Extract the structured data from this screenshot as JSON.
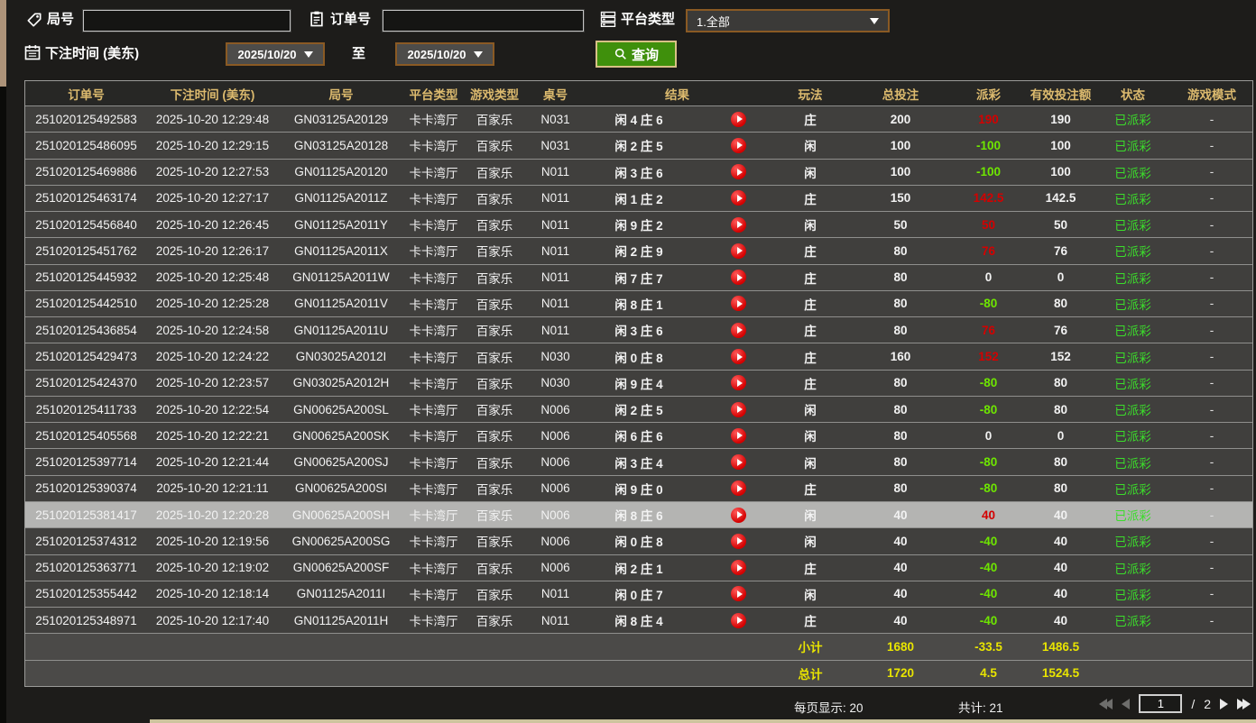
{
  "filters": {
    "round_no_label": "局号",
    "round_no_value": "",
    "order_no_label": "订单号",
    "order_no_value": "",
    "platform_label": "平台类型",
    "platform_value": "1.全部",
    "bet_time_label": "下注时间 (美东)",
    "date_from": "2025/10/20",
    "to_label": "至",
    "date_to": "2025/10/20",
    "query_label": "查询"
  },
  "colors": {
    "header_gold": "#dcba6e",
    "win_red": "#d40000",
    "loss_green": "#6ee600",
    "status_green": "#3bdd2b",
    "summary_yellow": "#e9e500",
    "query_button_green": "#3f900c"
  },
  "table": {
    "columns": [
      "订单号",
      "下注时间 (美东)",
      "局号",
      "平台类型",
      "游戏类型",
      "桌号",
      "结果",
      "玩法",
      "总投注",
      "派彩",
      "有效投注额",
      "状态",
      "游戏模式"
    ],
    "rows": [
      {
        "order": "251020125492583",
        "time": "2025-10-20 12:29:48",
        "round": "GN03125A20129",
        "platform": "卡卡湾厅",
        "game": "百家乐",
        "table_no": "N031",
        "result": "闲 4 庄 6",
        "play": "庄",
        "total_bet": "200",
        "payout": "190",
        "payout_class": "pos",
        "valid_bet": "190",
        "status": "已派彩",
        "mode": "-",
        "selected": false
      },
      {
        "order": "251020125486095",
        "time": "2025-10-20 12:29:15",
        "round": "GN03125A20128",
        "platform": "卡卡湾厅",
        "game": "百家乐",
        "table_no": "N031",
        "result": "闲 2 庄 5",
        "play": "闲",
        "total_bet": "100",
        "payout": "-100",
        "payout_class": "neg",
        "valid_bet": "100",
        "status": "已派彩",
        "mode": "-",
        "selected": false
      },
      {
        "order": "251020125469886",
        "time": "2025-10-20 12:27:53",
        "round": "GN01125A20120",
        "platform": "卡卡湾厅",
        "game": "百家乐",
        "table_no": "N011",
        "result": "闲 3 庄 6",
        "play": "闲",
        "total_bet": "100",
        "payout": "-100",
        "payout_class": "neg",
        "valid_bet": "100",
        "status": "已派彩",
        "mode": "-",
        "selected": false
      },
      {
        "order": "251020125463174",
        "time": "2025-10-20 12:27:17",
        "round": "GN01125A2011Z",
        "platform": "卡卡湾厅",
        "game": "百家乐",
        "table_no": "N011",
        "result": "闲 1 庄 2",
        "play": "庄",
        "total_bet": "150",
        "payout": "142.5",
        "payout_class": "pos",
        "valid_bet": "142.5",
        "status": "已派彩",
        "mode": "-",
        "selected": false
      },
      {
        "order": "251020125456840",
        "time": "2025-10-20 12:26:45",
        "round": "GN01125A2011Y",
        "platform": "卡卡湾厅",
        "game": "百家乐",
        "table_no": "N011",
        "result": "闲 9 庄 2",
        "play": "闲",
        "total_bet": "50",
        "payout": "50",
        "payout_class": "pos",
        "valid_bet": "50",
        "status": "已派彩",
        "mode": "-",
        "selected": false
      },
      {
        "order": "251020125451762",
        "time": "2025-10-20 12:26:17",
        "round": "GN01125A2011X",
        "platform": "卡卡湾厅",
        "game": "百家乐",
        "table_no": "N011",
        "result": "闲 2 庄 9",
        "play": "庄",
        "total_bet": "80",
        "payout": "76",
        "payout_class": "pos",
        "valid_bet": "76",
        "status": "已派彩",
        "mode": "-",
        "selected": false
      },
      {
        "order": "251020125445932",
        "time": "2025-10-20 12:25:48",
        "round": "GN01125A2011W",
        "platform": "卡卡湾厅",
        "game": "百家乐",
        "table_no": "N011",
        "result": "闲 7 庄 7",
        "play": "庄",
        "total_bet": "80",
        "payout": "0",
        "payout_class": "zero",
        "valid_bet": "0",
        "status": "已派彩",
        "mode": "-",
        "selected": false
      },
      {
        "order": "251020125442510",
        "time": "2025-10-20 12:25:28",
        "round": "GN01125A2011V",
        "platform": "卡卡湾厅",
        "game": "百家乐",
        "table_no": "N011",
        "result": "闲 8 庄 1",
        "play": "庄",
        "total_bet": "80",
        "payout": "-80",
        "payout_class": "neg",
        "valid_bet": "80",
        "status": "已派彩",
        "mode": "-",
        "selected": false
      },
      {
        "order": "251020125436854",
        "time": "2025-10-20 12:24:58",
        "round": "GN01125A2011U",
        "platform": "卡卡湾厅",
        "game": "百家乐",
        "table_no": "N011",
        "result": "闲 3 庄 6",
        "play": "庄",
        "total_bet": "80",
        "payout": "76",
        "payout_class": "pos",
        "valid_bet": "76",
        "status": "已派彩",
        "mode": "-",
        "selected": false
      },
      {
        "order": "251020125429473",
        "time": "2025-10-20 12:24:22",
        "round": "GN03025A2012I",
        "platform": "卡卡湾厅",
        "game": "百家乐",
        "table_no": "N030",
        "result": "闲 0 庄 8",
        "play": "庄",
        "total_bet": "160",
        "payout": "152",
        "payout_class": "pos",
        "valid_bet": "152",
        "status": "已派彩",
        "mode": "-",
        "selected": false
      },
      {
        "order": "251020125424370",
        "time": "2025-10-20 12:23:57",
        "round": "GN03025A2012H",
        "platform": "卡卡湾厅",
        "game": "百家乐",
        "table_no": "N030",
        "result": "闲 9 庄 4",
        "play": "庄",
        "total_bet": "80",
        "payout": "-80",
        "payout_class": "neg",
        "valid_bet": "80",
        "status": "已派彩",
        "mode": "-",
        "selected": false
      },
      {
        "order": "251020125411733",
        "time": "2025-10-20 12:22:54",
        "round": "GN00625A200SL",
        "platform": "卡卡湾厅",
        "game": "百家乐",
        "table_no": "N006",
        "result": "闲 2 庄 5",
        "play": "闲",
        "total_bet": "80",
        "payout": "-80",
        "payout_class": "neg",
        "valid_bet": "80",
        "status": "已派彩",
        "mode": "-",
        "selected": false
      },
      {
        "order": "251020125405568",
        "time": "2025-10-20 12:22:21",
        "round": "GN00625A200SK",
        "platform": "卡卡湾厅",
        "game": "百家乐",
        "table_no": "N006",
        "result": "闲 6 庄 6",
        "play": "闲",
        "total_bet": "80",
        "payout": "0",
        "payout_class": "zero",
        "valid_bet": "0",
        "status": "已派彩",
        "mode": "-",
        "selected": false
      },
      {
        "order": "251020125397714",
        "time": "2025-10-20 12:21:44",
        "round": "GN00625A200SJ",
        "platform": "卡卡湾厅",
        "game": "百家乐",
        "table_no": "N006",
        "result": "闲 3 庄 4",
        "play": "闲",
        "total_bet": "80",
        "payout": "-80",
        "payout_class": "neg",
        "valid_bet": "80",
        "status": "已派彩",
        "mode": "-",
        "selected": false
      },
      {
        "order": "251020125390374",
        "time": "2025-10-20 12:21:11",
        "round": "GN00625A200SI",
        "platform": "卡卡湾厅",
        "game": "百家乐",
        "table_no": "N006",
        "result": "闲 9 庄 0",
        "play": "庄",
        "total_bet": "80",
        "payout": "-80",
        "payout_class": "neg",
        "valid_bet": "80",
        "status": "已派彩",
        "mode": "-",
        "selected": false
      },
      {
        "order": "251020125381417",
        "time": "2025-10-20 12:20:28",
        "round": "GN00625A200SH",
        "platform": "卡卡湾厅",
        "game": "百家乐",
        "table_no": "N006",
        "result": "闲 8 庄 6",
        "play": "闲",
        "total_bet": "40",
        "payout": "40",
        "payout_class": "pos",
        "valid_bet": "40",
        "status": "已派彩",
        "mode": "-",
        "selected": true
      },
      {
        "order": "251020125374312",
        "time": "2025-10-20 12:19:56",
        "round": "GN00625A200SG",
        "platform": "卡卡湾厅",
        "game": "百家乐",
        "table_no": "N006",
        "result": "闲 0 庄 8",
        "play": "闲",
        "total_bet": "40",
        "payout": "-40",
        "payout_class": "neg",
        "valid_bet": "40",
        "status": "已派彩",
        "mode": "-",
        "selected": false
      },
      {
        "order": "251020125363771",
        "time": "2025-10-20 12:19:02",
        "round": "GN00625A200SF",
        "platform": "卡卡湾厅",
        "game": "百家乐",
        "table_no": "N006",
        "result": "闲 2 庄 1",
        "play": "庄",
        "total_bet": "40",
        "payout": "-40",
        "payout_class": "neg",
        "valid_bet": "40",
        "status": "已派彩",
        "mode": "-",
        "selected": false
      },
      {
        "order": "251020125355442",
        "time": "2025-10-20 12:18:14",
        "round": "GN01125A2011I",
        "platform": "卡卡湾厅",
        "game": "百家乐",
        "table_no": "N011",
        "result": "闲 0 庄 7",
        "play": "闲",
        "total_bet": "40",
        "payout": "-40",
        "payout_class": "neg",
        "valid_bet": "40",
        "status": "已派彩",
        "mode": "-",
        "selected": false
      },
      {
        "order": "251020125348971",
        "time": "2025-10-20 12:17:40",
        "round": "GN01125A2011H",
        "platform": "卡卡湾厅",
        "game": "百家乐",
        "table_no": "N011",
        "result": "闲 8 庄 4",
        "play": "庄",
        "total_bet": "40",
        "payout": "-40",
        "payout_class": "neg",
        "valid_bet": "40",
        "status": "已派彩",
        "mode": "-",
        "selected": false
      }
    ],
    "subtotal": {
      "label": "小计",
      "total_bet": "1680",
      "payout": "-33.5",
      "valid_bet": "1486.5"
    },
    "total": {
      "label": "总计",
      "total_bet": "1720",
      "payout": "4.5",
      "valid_bet": "1524.5"
    }
  },
  "footer": {
    "page_size_text": "每页显示: 20",
    "total_count_text": "共计: 21",
    "page_value": "1",
    "page_separator": "/",
    "total_pages": "2"
  }
}
